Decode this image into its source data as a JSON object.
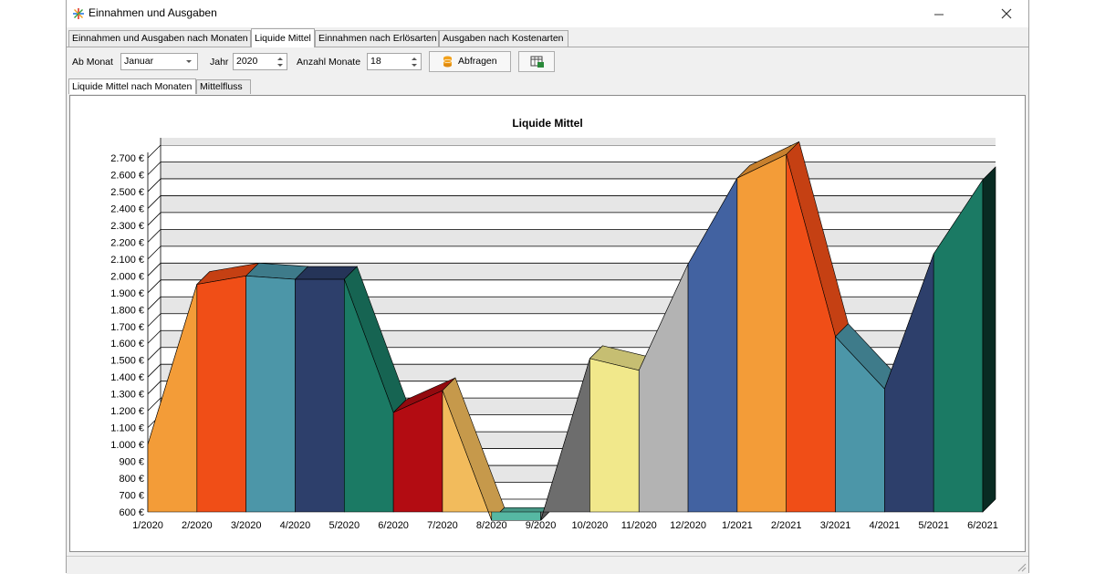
{
  "window": {
    "title": "Einnahmen und Ausgaben"
  },
  "tabs": [
    {
      "label": "Einnahmen und Ausgaben nach Monaten",
      "active": false
    },
    {
      "label": "Liquide Mittel",
      "active": true
    },
    {
      "label": "Einnahmen nach Erlösarten",
      "active": false
    },
    {
      "label": "Ausgaben nach Kostenarten",
      "active": false
    }
  ],
  "toolbar": {
    "ab_monat_label": "Ab Monat",
    "ab_monat_value": "Januar",
    "jahr_label": "Jahr",
    "jahr_value": "2020",
    "anzahl_label": "Anzahl Monate",
    "anzahl_value": "18",
    "abfragen_label": "Abfragen"
  },
  "subtabs": [
    {
      "label": "Liquide Mittel nach Monaten",
      "active": true
    },
    {
      "label": "Mittelfluss",
      "active": false
    }
  ],
  "icons": {
    "app": "sparkle-icon",
    "database": "database-icon",
    "export": "export-table-icon"
  },
  "chart_data": {
    "type": "area",
    "title": "Liquide Mittel",
    "categories": [
      "1/2020",
      "2/2020",
      "3/2020",
      "4/2020",
      "5/2020",
      "6/2020",
      "7/2020",
      "8/2020",
      "9/2020",
      "10/2020",
      "11/2020",
      "12/2020",
      "1/2021",
      "2/2021",
      "3/2021",
      "4/2021",
      "5/2021",
      "6/2021"
    ],
    "values": [
      1000,
      1950,
      2000,
      1980,
      1980,
      1190,
      1320,
      550,
      550,
      1510,
      1440,
      2070,
      2580,
      2720,
      1640,
      1330,
      2130,
      2570
    ],
    "colors": [
      "#f39c38",
      "#f04e17",
      "#4c96a8",
      "#2d3f6b",
      "#1b7a64",
      "#b30c12",
      "#f2bb5c",
      "#56b8a3",
      "#6d6d6d",
      "#f1e88b",
      "#b3b3b3",
      "#4262a1",
      "#f39c38",
      "#f04e17",
      "#4c96a8",
      "#2d3f6b",
      "#1b7a64",
      "#1b7a64"
    ],
    "y_ticks": [
      "600 €",
      "700 €",
      "800 €",
      "900 €",
      "1.000 €",
      "1.100 €",
      "1.200 €",
      "1.300 €",
      "1.400 €",
      "1.500 €",
      "1.600 €",
      "1.700 €",
      "1.800 €",
      "1.900 €",
      "2.000 €",
      "2.100 €",
      "2.200 €",
      "2.300 €",
      "2.400 €",
      "2.500 €",
      "2.600 €",
      "2.700 €"
    ],
    "ylim": [
      600,
      2700
    ],
    "grid": true,
    "legend": "none"
  }
}
